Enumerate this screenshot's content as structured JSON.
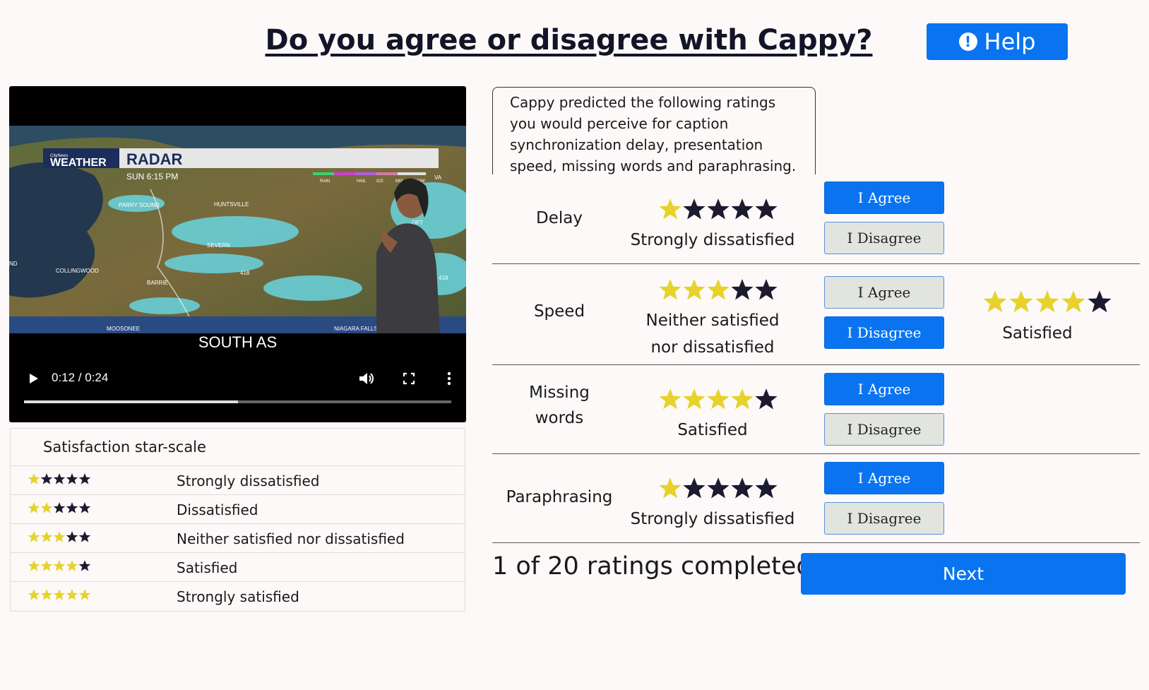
{
  "header": {
    "title": "Do you agree or disagree with Cappy?",
    "help_label": "Help"
  },
  "video": {
    "caption": "SOUTH AS",
    "time": "0:12 / 0:24",
    "progress": 0.5,
    "overlay": {
      "brand_small": "CityNews",
      "brand": "WEATHER",
      "title": "RADAR",
      "subtitle": "SUN 6:15 PM",
      "legend": [
        "RAIN",
        "HAIL",
        "ICE",
        "MIX",
        "SNOW"
      ],
      "places": [
        "PARRY SOUND",
        "HUNTSVILLE",
        "SEVERN",
        "COLLINGWOOD",
        "BARRIE",
        "MOOSONEE",
        "NIAGARA FALLS",
        "OFT",
        "VA",
        "ND",
        "418",
        "418"
      ]
    }
  },
  "scale": {
    "title": "Satisfaction star-scale",
    "rows": [
      {
        "stars": 1,
        "label": "Strongly dissatisfied"
      },
      {
        "stars": 2,
        "label": "Dissatisfied"
      },
      {
        "stars": 3,
        "label": "Neither satisfied nor dissatisfied"
      },
      {
        "stars": 4,
        "label": "Satisfied"
      },
      {
        "stars": 5,
        "label": "Strongly satisfied"
      }
    ]
  },
  "description": "Cappy predicted the following ratings you would perceive for caption synchronization delay, presentation speed, missing words and paraphrasing.",
  "ratings": [
    {
      "metric_lines": [
        "Delay"
      ],
      "stars": 1,
      "desc_lines": [
        "Strongly dissatisfied"
      ],
      "agree_label": "I Agree",
      "disagree_label": "I Disagree",
      "selected": "agree"
    },
    {
      "metric_lines": [
        "Speed"
      ],
      "stars": 3,
      "desc_lines": [
        "Neither satisfied",
        "nor dissatisfied"
      ],
      "agree_label": "I Agree",
      "disagree_label": "I Disagree",
      "selected": "disagree",
      "user_stars": 4,
      "user_desc": "Satisfied"
    },
    {
      "metric_lines": [
        "Missing",
        "words"
      ],
      "stars": 4,
      "desc_lines": [
        "Satisfied"
      ],
      "agree_label": "I Agree",
      "disagree_label": "I Disagree",
      "selected": "agree"
    },
    {
      "metric_lines": [
        "Paraphrasing"
      ],
      "stars": 1,
      "desc_lines": [
        "Strongly dissatisfied"
      ],
      "agree_label": "I Agree",
      "disagree_label": "I Disagree",
      "selected": "agree"
    }
  ],
  "footer": {
    "progress_text": "1 of 20 ratings completed",
    "next_label": "Next"
  },
  "colors": {
    "primary": "#0a74f0",
    "star_filled": "#e6d22b",
    "star_empty": "#1c1a2e"
  }
}
